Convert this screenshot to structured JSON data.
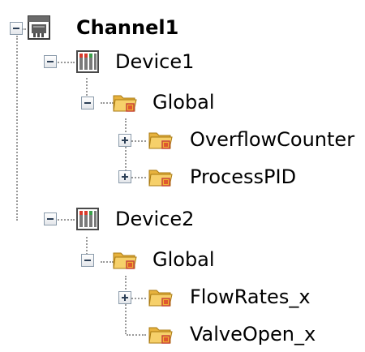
{
  "tree": {
    "channel": {
      "label": "Channel1",
      "icon": "channel-icon",
      "expanded": true
    },
    "devices": [
      {
        "label": "Device1",
        "icon": "device-icon",
        "expanded": true,
        "group": {
          "label": "Global",
          "icon": "folder-icon",
          "expanded": true,
          "children": [
            {
              "label": "OverflowCounter",
              "icon": "folder-icon",
              "expander": "plus"
            },
            {
              "label": "ProcessPID",
              "icon": "folder-icon",
              "expander": "plus"
            }
          ]
        }
      },
      {
        "label": "Device2",
        "icon": "device-icon",
        "expanded": true,
        "group": {
          "label": "Global",
          "icon": "folder-icon",
          "expanded": true,
          "children": [
            {
              "label": "FlowRates_x",
              "icon": "folder-icon",
              "expander": "plus"
            },
            {
              "label": "ValveOpen_x",
              "icon": "folder-icon",
              "expander": "none"
            }
          ]
        }
      }
    ]
  },
  "colors": {
    "folder": "#f2c14e",
    "folder_dark": "#d09a1f",
    "tag_red": "#d83a2b",
    "device_frame": "#5a5a5a",
    "connector": "#9a9a9a"
  }
}
